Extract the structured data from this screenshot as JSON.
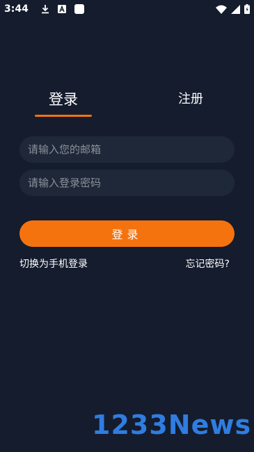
{
  "status_bar": {
    "time": "3:44",
    "icons_left": [
      "download-icon",
      "a-badge-icon",
      "square-icon"
    ],
    "icons_right": [
      "wifi-icon",
      "signal-icon",
      "battery-icon"
    ]
  },
  "tabs": {
    "login": "登录",
    "register": "注册",
    "active": "login"
  },
  "form": {
    "email_placeholder": "请输入您的邮箱",
    "password_placeholder": "请输入登录密码",
    "email_value": "",
    "password_value": ""
  },
  "login_button": "登录",
  "links": {
    "switch_phone": "切换为手机登录",
    "forgot_password": "忘记密码?"
  },
  "watermark": "1233News",
  "colors": {
    "background": "#141c2d",
    "field_bg": "#1f2838",
    "accent": "#f5730f",
    "watermark": "#2f7de1"
  }
}
